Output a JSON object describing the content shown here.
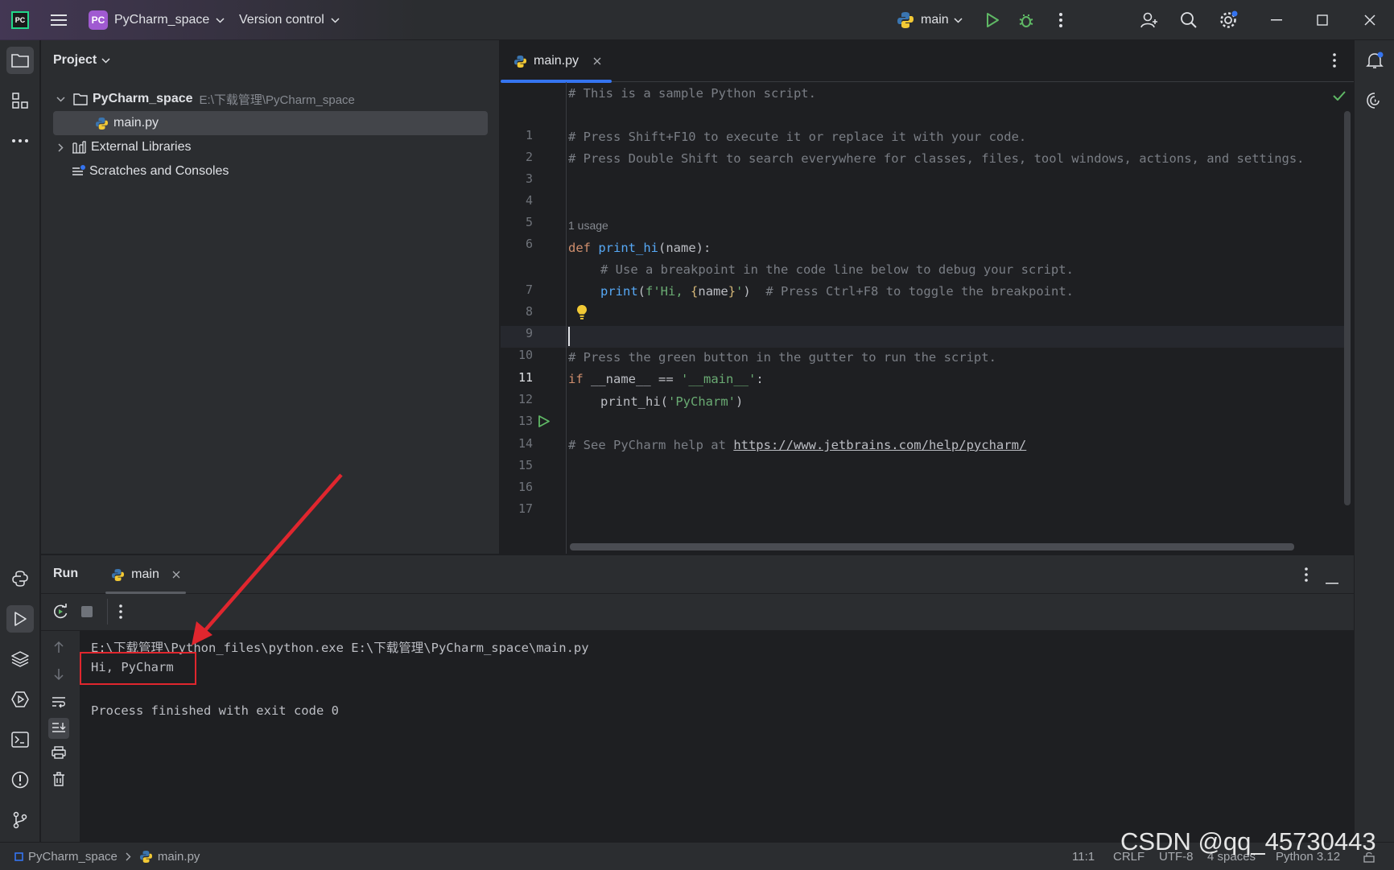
{
  "titlebar": {
    "logo": "PC",
    "project_badge": "PC",
    "project_name": "PyCharm_space",
    "vcs_label": "Version control",
    "run_config": "main"
  },
  "project_panel": {
    "title": "Project",
    "tree": [
      {
        "label": "PyCharm_space",
        "path": "E:\\下载管理\\PyCharm_space"
      },
      {
        "label": "main.py"
      },
      {
        "label": "External Libraries"
      },
      {
        "label": "Scratches and Consoles"
      }
    ]
  },
  "editor": {
    "tab_label": "main.py",
    "line_numbers": [
      "1",
      "2",
      "3",
      "4",
      "5",
      "6",
      "7",
      "8",
      "9",
      "10",
      "11",
      "12",
      "13",
      "14",
      "15",
      "16",
      "17"
    ],
    "usage_hint": "1 usage",
    "lines": {
      "l1": "# This is a sample Python script.",
      "l3": "# Press Shift+F10 to execute it or replace it with your code.",
      "l4": "# Press Double Shift to search everywhere for classes, files, tool windows, actions, and settings.",
      "l7_kw": "def",
      "l7_fn": "print_hi",
      "l7_rest": "(name):",
      "l8": "# Use a breakpoint in the code line below to debug your script.",
      "l9_fn": "print",
      "l9_open": "(",
      "l9_str1": "f'Hi, ",
      "l9_b1": "{",
      "l9_name": "name",
      "l9_b2": "}",
      "l9_str2": "'",
      "l9_close": ")",
      "l9_comment": "# Press Ctrl+F8 to toggle the breakpoint.",
      "l12": "# Press the green button in the gutter to run the script.",
      "l13_kw": "if",
      "l13_mid": " __name__ == ",
      "l13_str": "'__main__'",
      "l13_end": ":",
      "l14_fn": "print_hi",
      "l14_open": "(",
      "l14_str": "'PyCharm'",
      "l14_close": ")",
      "l16_comment": "# See PyCharm help at ",
      "l16_link": "https://www.jetbrains.com/help/pycharm/"
    }
  },
  "run_panel": {
    "title": "Run",
    "tab_label": "main",
    "console": {
      "cmd": "E:\\下载管理\\Python_files\\python.exe E:\\下载管理\\PyCharm_space\\main.py",
      "output": "Hi, PyCharm",
      "exit": "Process finished with exit code 0"
    }
  },
  "statusbar": {
    "breadcrumb_project": "PyCharm_space",
    "breadcrumb_file": "main.py",
    "position": "11:1",
    "line_ending": "CRLF",
    "encoding": "UTF-8",
    "indent": "4 spaces",
    "interpreter": "Python 3.12"
  },
  "watermark": "CSDN @qq_45730443",
  "colors": {
    "accent": "#3574f0",
    "highlight_box": "#e0262e",
    "run_green": "#5fb865"
  }
}
